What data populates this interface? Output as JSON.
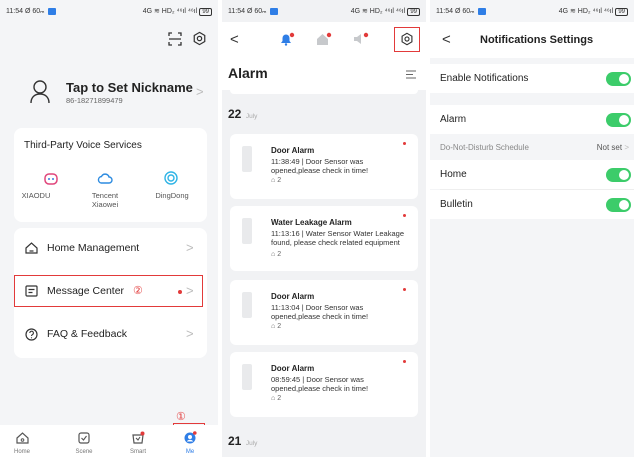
{
  "status": {
    "time": "11:54",
    "left_icons": "Ø 60ₘ",
    "right_icons": "4G ≋ HD₂ ⁴⁶ıl ⁴⁶ıl",
    "battery": "99"
  },
  "me": {
    "nickname": "Tap to Set Nickname",
    "phone": "86-18271899479",
    "voice_title": "Third-Party Voice Services",
    "voice_services": [
      {
        "label": "XIAODU",
        "icon": "xiaodu-icon"
      },
      {
        "label": "Tencent\nXiaowei",
        "icon": "tencent-cloud-icon"
      },
      {
        "label": "DingDong",
        "icon": "dingdong-icon"
      }
    ],
    "menu": [
      {
        "label": "Home Management",
        "icon": "home-outline-icon"
      },
      {
        "label": "Message Center",
        "icon": "message-icon"
      },
      {
        "label": "FAQ & Feedback",
        "icon": "question-icon"
      }
    ],
    "callout_1": "①",
    "callout_2": "②",
    "tabs": [
      "Home",
      "Scene",
      "Smart",
      "Me"
    ]
  },
  "alarm": {
    "title": "Alarm",
    "date_groups": [
      {
        "day": "22",
        "month": "July"
      },
      {
        "day": "21",
        "month": "July"
      }
    ],
    "items": [
      {
        "title": "Door Alarm",
        "desc": "11:38:49 | Door Sensor was opened,please check in time!",
        "home": "2"
      },
      {
        "title": "Water Leakage Alarm",
        "desc": "11:13:16 | Water Sensor Water Leakage found, please check related equipment",
        "home": "2"
      },
      {
        "title": "Door Alarm",
        "desc": "11:13:04 | Door Sensor was opened,please check in time!",
        "home": "2"
      },
      {
        "title": "Door Alarm",
        "desc": "08:59:45 | Door Sensor was opened,please check in time!",
        "home": "2"
      }
    ]
  },
  "settings": {
    "title": "Notifications Settings",
    "enable_label": "Enable Notifications",
    "rows": [
      {
        "label": "Alarm",
        "on": true
      },
      {
        "label": "Home",
        "on": true
      },
      {
        "label": "Bulletin",
        "on": true
      }
    ],
    "dnd_label": "Do-Not-Disturb Schedule",
    "dnd_value": "Not set"
  },
  "colors": {
    "accent_green": "#3ccc6a",
    "alert_red": "#e23a3a",
    "brand_blue": "#2f7ee6"
  }
}
